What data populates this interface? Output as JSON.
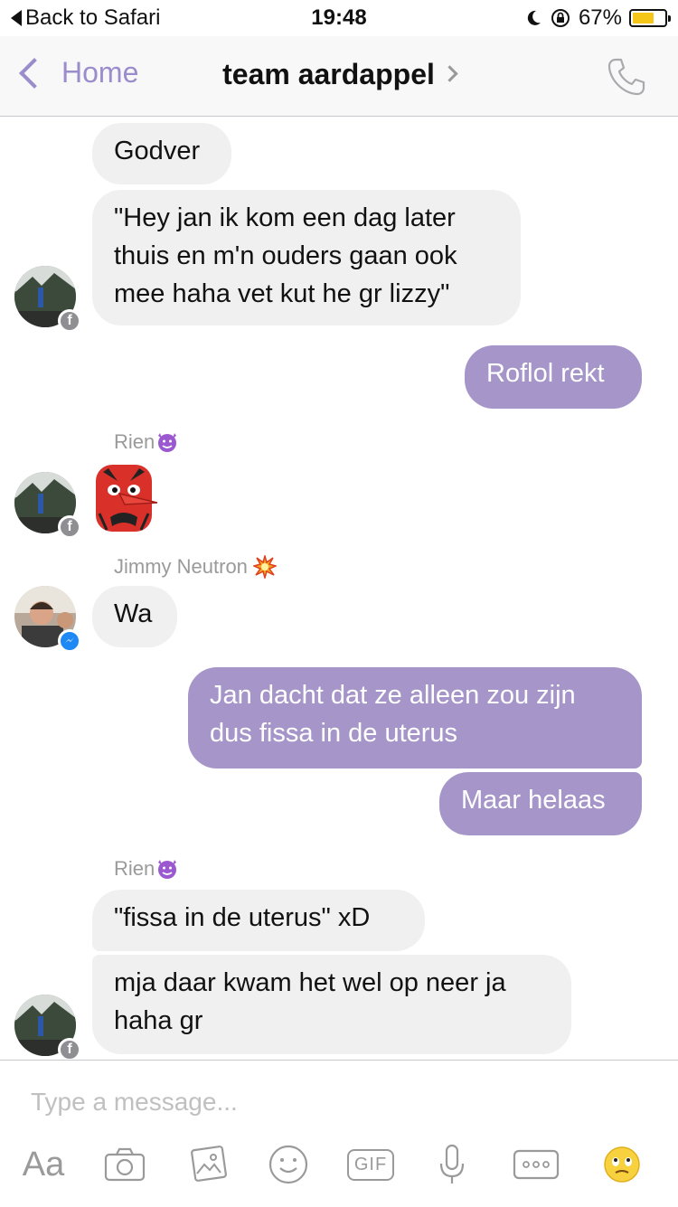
{
  "status_bar": {
    "back_label": "Back to Safari",
    "time": "19:48",
    "battery": "67%",
    "battery_level": 0.67,
    "battery_color": "#f5c518"
  },
  "nav": {
    "back_label": "Home",
    "title": "team aardappel",
    "call_icon": "phone-icon",
    "accent": "#9b8ccc"
  },
  "messages": [
    {
      "dir": "in",
      "text": "Godver"
    },
    {
      "dir": "in",
      "text": "\"Hey jan ik kom een dag later\nthuis en m'n ouders gaan ook\nmee haha vet kut he gr lizzy\""
    },
    {
      "dir": "out",
      "text": "Roflol rekt"
    },
    {
      "dir": "in",
      "sender": "Rien",
      "sender_emoji": "purple-devil-icon",
      "sticker": "red-tengu-mask-sticker"
    },
    {
      "dir": "in",
      "sender": "Jimmy Neutron",
      "sender_emoji": "collision-icon",
      "text": "Wa"
    },
    {
      "dir": "out",
      "text": "Jan dacht dat ze alleen zou zijn\ndus fissa in de uterus"
    },
    {
      "dir": "out",
      "text": "Maar helaas"
    },
    {
      "dir": "in",
      "sender": "Rien",
      "sender_emoji": "purple-devil-icon",
      "text": "\"fissa in de uterus\" xD"
    },
    {
      "dir": "in",
      "text": "mja daar kwam het wel op neer ja\nhaha gr"
    }
  ],
  "composer": {
    "placeholder": "Type a message...",
    "aa_label": "Aa",
    "gif_label": "GIF",
    "tools": [
      "aa-icon",
      "camera-icon",
      "gallery-icon",
      "smiley-icon",
      "gif-icon",
      "microphone-icon",
      "more-icon",
      "emoji-icon"
    ]
  },
  "colors": {
    "outgoing_bubble": "#a595c8",
    "incoming_bubble": "#f0f0f0"
  }
}
